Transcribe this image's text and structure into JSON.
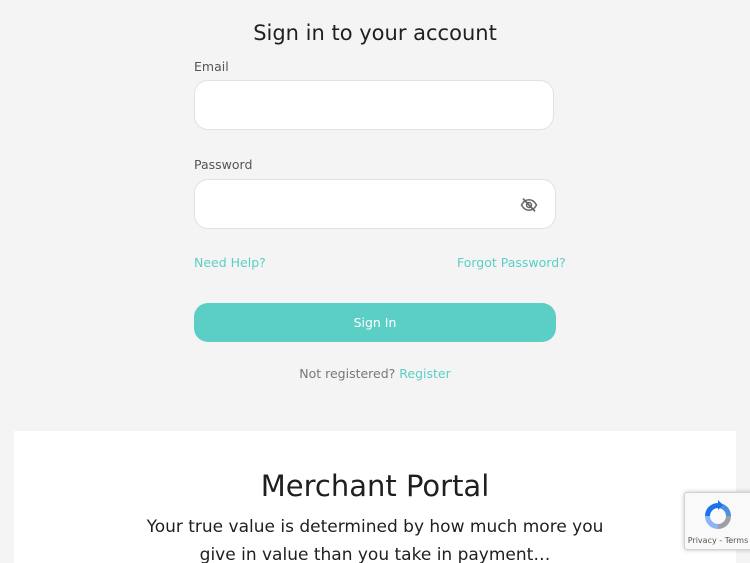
{
  "login": {
    "title": "Sign in to your account",
    "email_label": "Email",
    "email_value": "",
    "password_label": "Password",
    "password_value": "",
    "password_toggle_icon": "eye-slash-icon",
    "need_help": "Need Help?",
    "forgot_password": "Forgot Password?",
    "signin_label": "Sign In",
    "not_registered": "Not registered?",
    "register": "Register"
  },
  "portal": {
    "title": "Merchant Portal",
    "tagline": "Your true value is determined by how much more you give in value than you take in payment…"
  },
  "recaptcha": {
    "privacy": "Privacy",
    "separator": "-",
    "terms": "Terms"
  },
  "colors": {
    "accent": "#5bcfc6",
    "background": "#f4f4f4",
    "panel": "#ffffff"
  }
}
